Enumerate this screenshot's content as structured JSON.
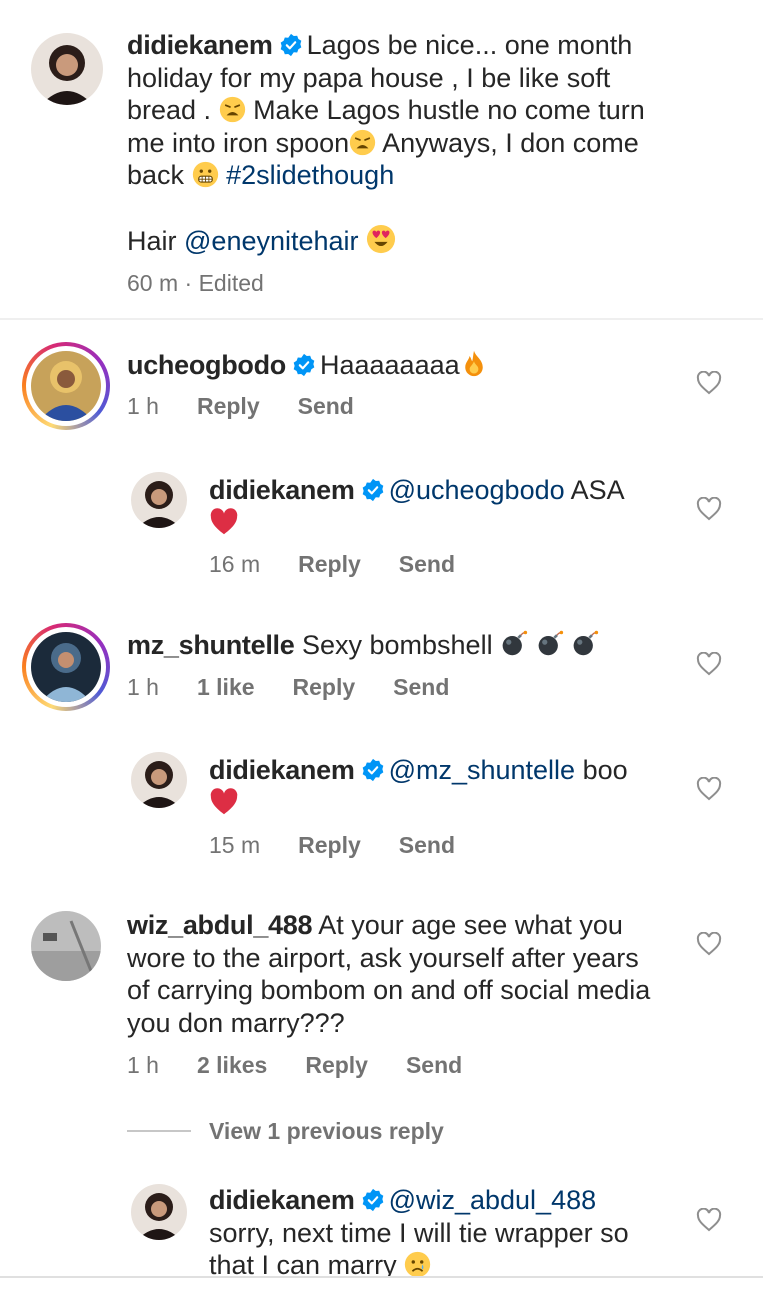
{
  "caption": {
    "username": "didiekanem",
    "lines": [
      "Lagos be nice... one month",
      "holiday for my papa house , I be like soft",
      "bread . ",
      " Make Lagos hustle no come turn",
      "me into iron spoon",
      " Anyways, I don come",
      "back ",
      "#2slidethough"
    ],
    "hair_prefix": "Hair ",
    "hair_tag": "@eneynitehair",
    "time": "60 m",
    "edited": "· Edited"
  },
  "comments": [
    {
      "username": "ucheogbodo",
      "text": "Haaaaaaaa",
      "time": "1 h",
      "reply": "Reply",
      "send": "Send"
    },
    {
      "username": "didiekanem",
      "mention": "@ucheogbodo",
      "text": " ASA",
      "time": "16 m",
      "reply": "Reply",
      "send": "Send"
    },
    {
      "username": "mz_shuntelle",
      "text": "Sexy bombshell",
      "time": "1 h",
      "likes": "1 like",
      "reply": "Reply",
      "send": "Send"
    },
    {
      "username": "didiekanem",
      "mention": "@mz_shuntelle",
      "text": " boo",
      "time": "15 m",
      "reply": "Reply",
      "send": "Send"
    },
    {
      "username": "wiz_abdul_488",
      "lines": [
        "At your age see what you",
        "wore to the airport, ask yourself after years",
        "of carrying bombom on and off social media",
        "you don marry???"
      ],
      "time": "1 h",
      "likes": "2 likes",
      "reply": "Reply",
      "send": "Send"
    },
    {
      "username": "didiekanem",
      "mention": "@wiz_abdul_488",
      "lines": [
        "sorry, next time I will tie wrapper so",
        "that I can marry "
      ]
    }
  ],
  "view_previous": "View 1 previous reply",
  "icons": {
    "verified": "verified-badge-icon",
    "like": "heart-outline-icon",
    "weary": "weary-face-emoji",
    "grimace": "grimacing-face-emoji",
    "heart_eyes": "heart-eyes-emoji",
    "fire": "fire-emoji",
    "red_heart": "red-heart-emoji",
    "bomb": "bomb-emoji",
    "crying": "crying-face-emoji"
  },
  "colors": {
    "text": "#262626",
    "muted": "#737373",
    "link": "#00376b",
    "verified": "#0095f6"
  }
}
